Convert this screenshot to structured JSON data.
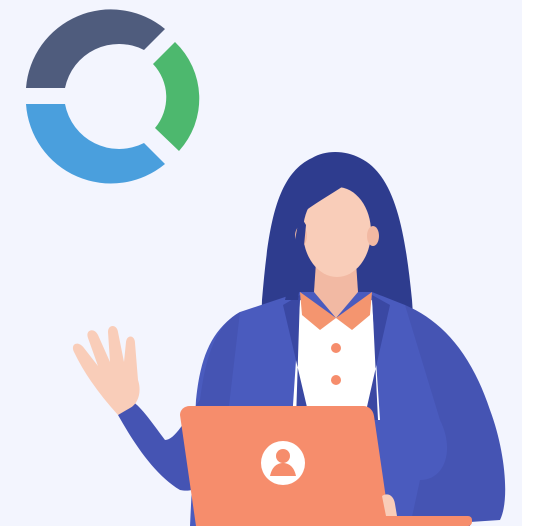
{
  "illustration": {
    "logo": {
      "icon": "segmented-ring-logo",
      "colors": {
        "dark": "#4F5C7D",
        "green": "#4DB86E",
        "blue": "#4A9FDD"
      }
    },
    "person": {
      "icon": "woman-with-laptop",
      "colors": {
        "hair": "#2E3C8E",
        "skin": "#F9CDB9",
        "blazer": "#4A5BBE",
        "shirt": "#FFFFFF",
        "collar": "#F4956F",
        "laptop": "#F68D6C"
      }
    },
    "laptop_badge": {
      "icon": "user-avatar-icon"
    },
    "background": "#F3F5FE"
  }
}
